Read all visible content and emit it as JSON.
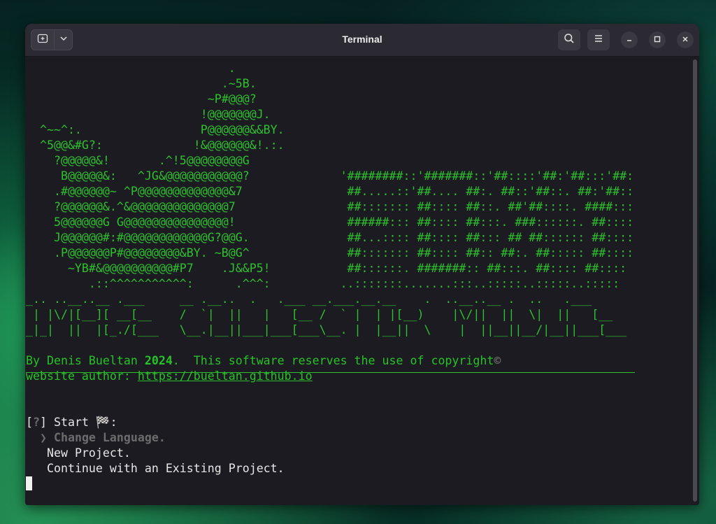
{
  "window": {
    "title": "Terminal",
    "icons": {
      "new_tab": "new-tab-icon",
      "dropdown": "chevron-down-icon",
      "search": "search-icon",
      "menu": "hamburger-menu-icon",
      "minimize": "minimize-icon",
      "maximize": "maximize-icon",
      "close": "close-icon"
    }
  },
  "colors": {
    "terminal_bg": "#1c1b22",
    "green": "#2ec02e",
    "white": "#e6e6e6",
    "gray": "#6c6c6c"
  },
  "terminal": {
    "art_lines": [
      "                             .",
      "                            .~5B.",
      "                          ~P#@@@?",
      "                         !@@@@@@@J.",
      "  ^~~^:.                 P@@@@@@&&BY.",
      "  ^5@@&#G?:             !&@@@@@@&!.:.",
      "    ?@@@@@&!       .^!5@@@@@@@@G",
      "     B@@@@@&:   ^JG&@@@@@@@@@@@?             '########::'#######::'##::::'##:'##:::'##:",
      "    .#@@@@@@~ ^P@@@@@@@@@@@@@&7               ##.....::'##.... ##:. ##::'##::. ##:'##::",
      "    ?@@@@@@&.^&@@@@@@@@@@@@@@7                ##::::::: ##:::: ##::. ##'##::::. ####:::",
      "    5@@@@@@G G@@@@@@@@@@@@@@@!                ######::: ##:::: ##:::. ###::::::. ##::::",
      "    J@@@@@@#:#@@@@@@@@@@@@G?@@G.              ##...:::: ##:::: ##::: ## ##:::::: ##::::",
      "    .P@@@@@@P#@@@@@@@@&BY. ~B@G^              ##::::::: ##:::: ##:: ##:. ##::::: ##::::",
      "      ~YB#&@@@@@@@@@@#P7    .J&&P5!           ##::::::. #######:: ##:::. ##:::: ##::::",
      "         .::^^^^^^^^^^^:      .^^^:          ..:::::::.......:::..:::::..:::::..:::::",
      "_.. ..__..__ .___     __ .__..  .   .___ __.___.__.__    .  ..__..__ .  ..   .___",
      " | |\\/|[__][ __[__    /  `|  ||   |   [__ /  ` |  | |[__)    |\\/||  ||  \\|  ||   [__",
      "_|_|  ||  |[_./[___   \\__.|__||___|___[___\\__. |  |__||  \\    |  ||__||__/|__||___[___"
    ],
    "copyright_prefix": "By Denis Bueltan ",
    "copyright_year": "2024",
    "copyright_text": ".  This software reserves the use of copyright",
    "copyright_symbol": "©",
    "website_label": "website author: ",
    "website_url": "https://bueltan.github.io",
    "prompt_open": "[",
    "prompt_q": "?",
    "prompt_close": "]",
    "prompt_text": " Start 🏁:",
    "menu_pointer": "❯",
    "menu_items": [
      "Change Language.",
      "New Project.",
      "Continue with an Existing Project."
    ]
  }
}
